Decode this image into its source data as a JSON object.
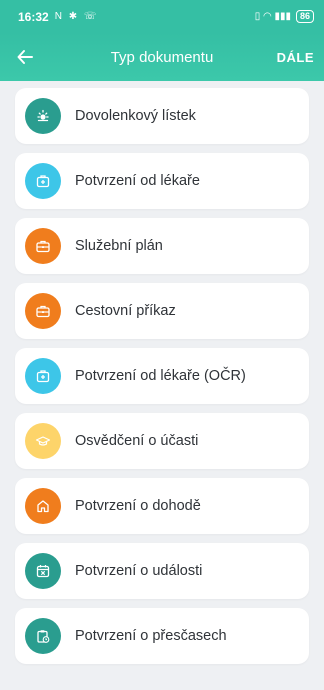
{
  "status": {
    "time": "16:32",
    "left_icons": "N ✱ ☏",
    "signal_icons": "▯ ◠ ▮▮▮",
    "battery": "86"
  },
  "appbar": {
    "title": "Typ dokumentu",
    "next_label": "DÁLE",
    "accent_color": "#35bfa4"
  },
  "items": [
    {
      "label": "Dovolenkový lístek",
      "icon": "sun-icon",
      "color": "#2a9d8f"
    },
    {
      "label": "Potvrzení od lékaře",
      "icon": "medical-kit-icon",
      "color": "#3dc6e8"
    },
    {
      "label": "Služební plán",
      "icon": "briefcase-icon",
      "color": "#f07d1d"
    },
    {
      "label": "Cestovní příkaz",
      "icon": "briefcase-icon",
      "color": "#f07d1d"
    },
    {
      "label": "Potvrzení od lékaře (OČR)",
      "icon": "medical-kit-icon",
      "color": "#3dc6e8"
    },
    {
      "label": "Osvědčení o účasti",
      "icon": "graduation-cap-icon",
      "color": "#fdd46a"
    },
    {
      "label": "Potvrzení o dohodě",
      "icon": "home-icon",
      "color": "#f07d1d"
    },
    {
      "label": "Potvrzení o události",
      "icon": "calendar-x-icon",
      "color": "#2a9d8f"
    },
    {
      "label": "Potvrzení o přesčasech",
      "icon": "clipboard-clock-icon",
      "color": "#2a9d8f"
    }
  ]
}
